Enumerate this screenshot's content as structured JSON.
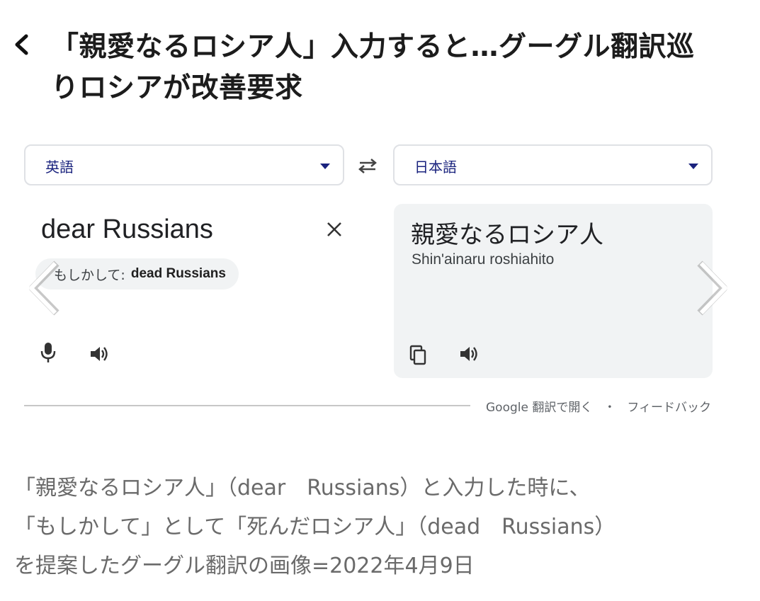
{
  "header": {
    "title_line1": "「親愛なるロシア人」入力すると…グーグル翻訳巡",
    "title_line2": "りロシアが改善要求"
  },
  "translate": {
    "source_lang": "英語",
    "target_lang": "日本語",
    "source_text": "dear Russians",
    "suggestion_prefix": "もしかして:",
    "suggestion_value": "dead Russians",
    "target_text": "親愛なるロシア人",
    "transliteration": "Shin'ainaru roshiahito",
    "footer_open": "Google 翻訳で開く",
    "footer_separator": "・",
    "footer_feedback": "フィードバック"
  },
  "caption": {
    "line1": "「親愛なるロシア人」（dear　Russians）と入力した時に、",
    "line2": "「もしかして」として「死んだロシア人」（dead　Russians）",
    "line3": "を提案したグーグル翻訳の画像=2022年4月9日"
  },
  "colors": {
    "accent": "#1a237e",
    "panel_bg": "#f1f3f4",
    "border": "#dfe1e5",
    "caption_text": "#6a6a6a"
  }
}
